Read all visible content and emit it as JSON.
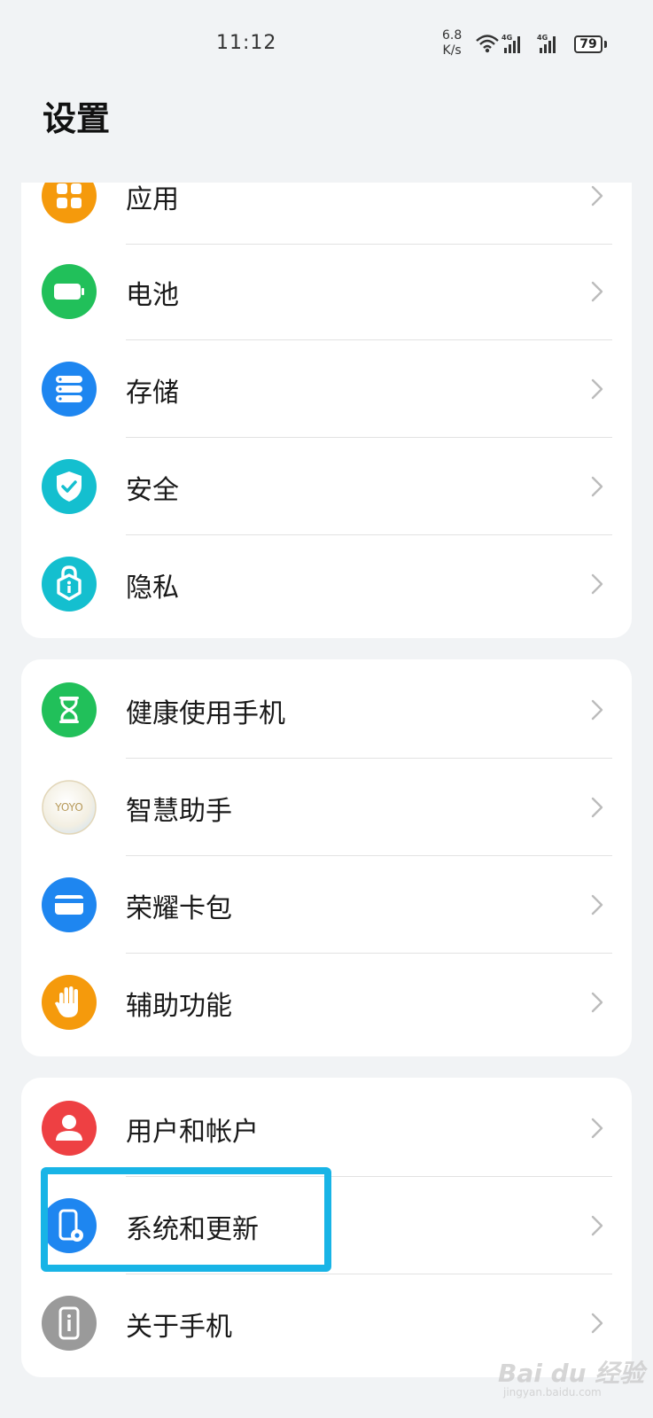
{
  "status_bar": {
    "time": "11:12",
    "net_speed_value": "6.8",
    "net_speed_unit": "K/s",
    "battery_level": "79",
    "icons": [
      "wifi-icon",
      "signal-4g-icon",
      "signal-4g-icon",
      "battery-icon"
    ]
  },
  "page": {
    "title": "设置"
  },
  "groups": [
    {
      "items": [
        {
          "label": "应用",
          "icon": "apps-icon",
          "color": "#f59a0c"
        },
        {
          "label": "电池",
          "icon": "battery-icon",
          "color": "#21c05a"
        },
        {
          "label": "存储",
          "icon": "storage-icon",
          "color": "#1e86f0"
        },
        {
          "label": "安全",
          "icon": "shield-icon",
          "color": "#14bfcf"
        },
        {
          "label": "隐私",
          "icon": "privacy-lock-icon",
          "color": "#14bfcf"
        }
      ]
    },
    {
      "items": [
        {
          "label": "健康使用手机",
          "icon": "hourglass-icon",
          "color": "#21c05a"
        },
        {
          "label": "智慧助手",
          "icon": "yoyo-icon",
          "color": "#f4f1e6"
        },
        {
          "label": "荣耀卡包",
          "icon": "wallet-icon",
          "color": "#1e86f0"
        },
        {
          "label": "辅助功能",
          "icon": "hand-icon",
          "color": "#f59a0c"
        }
      ]
    },
    {
      "items": [
        {
          "label": "用户和帐户",
          "icon": "user-icon",
          "color": "#ee4043"
        },
        {
          "label": "系统和更新",
          "icon": "system-update-icon",
          "color": "#1e86f0"
        },
        {
          "label": "关于手机",
          "icon": "about-phone-icon",
          "color": "#9a9a9a"
        }
      ]
    }
  ],
  "yoyo_text": "YOYO",
  "watermark": {
    "text": "Bai du 经验",
    "sub": "jingyan.baidu.com"
  }
}
